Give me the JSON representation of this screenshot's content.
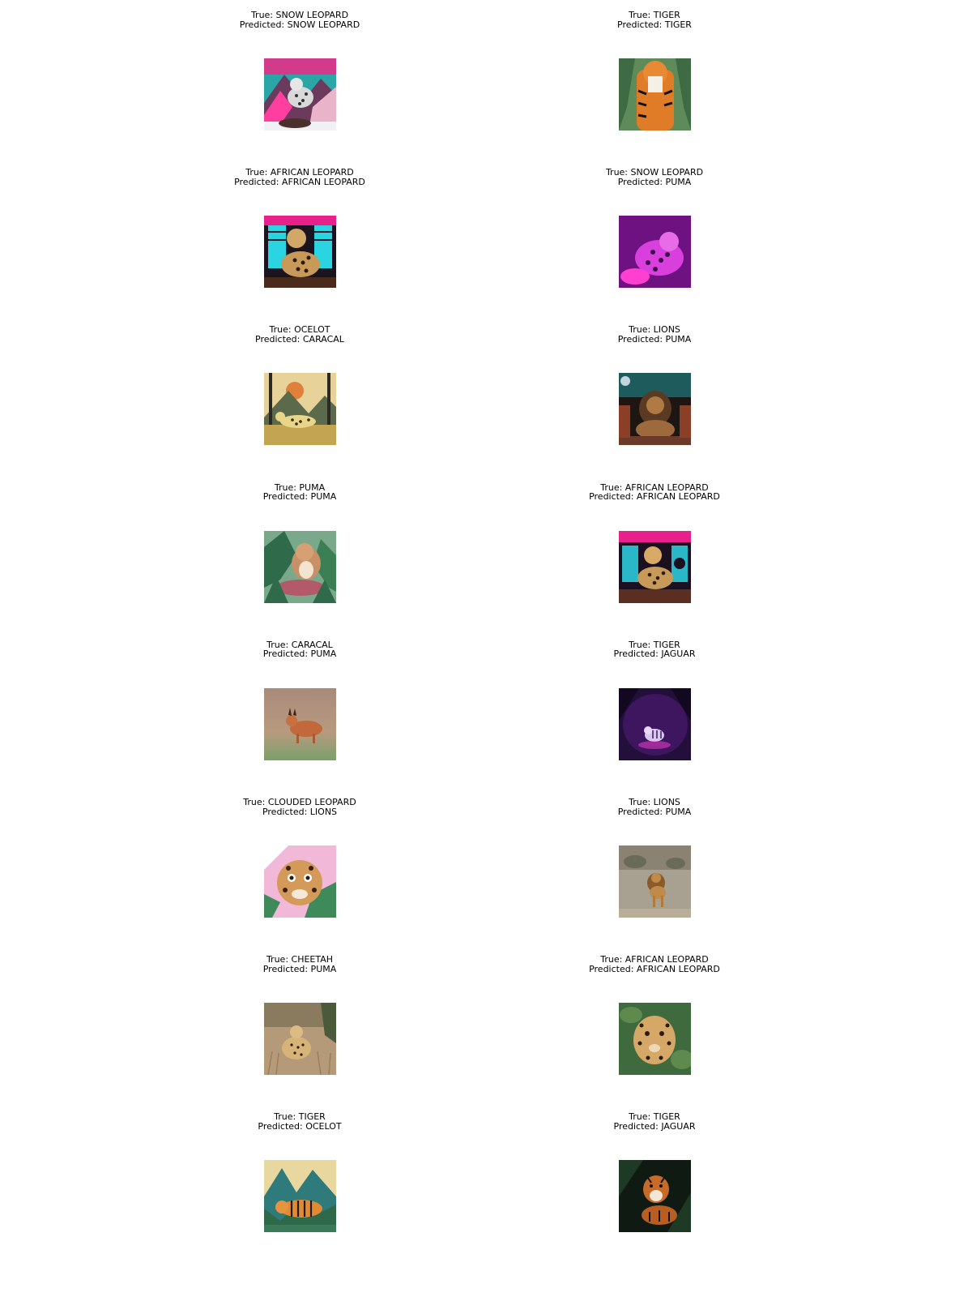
{
  "figure": {
    "true_prefix": "True: ",
    "pred_prefix": "Predicted: ",
    "panels": [
      {
        "true": "SNOW LEOPARD",
        "predicted": "SNOW LEOPARD",
        "image": "snow-leopard-pink-mountains"
      },
      {
        "true": "TIGER",
        "predicted": "TIGER",
        "image": "tiger-green-jungle"
      },
      {
        "true": "AFRICAN LEOPARD",
        "predicted": "AFRICAN LEOPARD",
        "image": "leopard-neon-arcade"
      },
      {
        "true": "SNOW LEOPARD",
        "predicted": "PUMA",
        "image": "snow-leopard-magenta-glow"
      },
      {
        "true": "OCELOT",
        "predicted": "CARACAL",
        "image": "ocelot-forest-sunset"
      },
      {
        "true": "LIONS",
        "predicted": "PUMA",
        "image": "lion-dark-teal-sky"
      },
      {
        "true": "PUMA",
        "predicted": "PUMA",
        "image": "puma-green-foliage"
      },
      {
        "true": "AFRICAN LEOPARD",
        "predicted": "AFRICAN LEOPARD",
        "image": "leopard-neon-room"
      },
      {
        "true": "CARACAL",
        "predicted": "PUMA",
        "image": "caracal-blurred-field"
      },
      {
        "true": "TIGER",
        "predicted": "JAGUAR",
        "image": "tiger-purple-night"
      },
      {
        "true": "CLOUDED LEOPARD",
        "predicted": "LIONS",
        "image": "clouded-leopard-pink-cartoon"
      },
      {
        "true": "LIONS",
        "predicted": "PUMA",
        "image": "lion-dry-savanna"
      },
      {
        "true": "CHEETAH",
        "predicted": "PUMA",
        "image": "cheetah-tall-grass"
      },
      {
        "true": "AFRICAN LEOPARD",
        "predicted": "AFRICAN LEOPARD",
        "image": "leopard-green-leaves"
      },
      {
        "true": "TIGER",
        "predicted": "OCELOT",
        "image": "tiger-teal-mountains"
      },
      {
        "true": "TIGER",
        "predicted": "JAGUAR",
        "image": "tiger-dark-jungle"
      }
    ]
  }
}
